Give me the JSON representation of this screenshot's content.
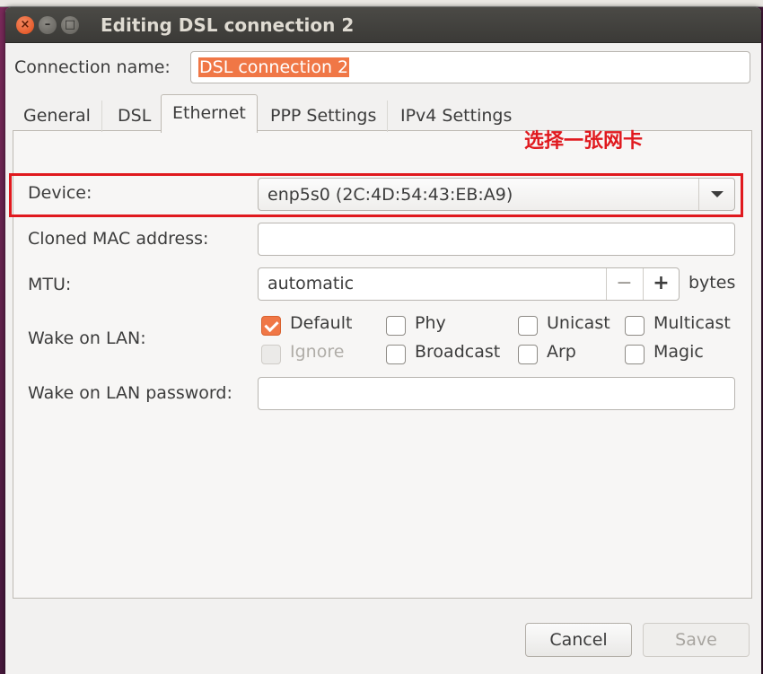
{
  "window": {
    "title": "Editing DSL connection 2",
    "controls": {
      "close": "×",
      "minimize": "–",
      "maximize": "□"
    }
  },
  "connection_name": {
    "label": "Connection name:",
    "value": "DSL connection 2"
  },
  "tabs": [
    {
      "label": "General"
    },
    {
      "label": "DSL"
    },
    {
      "label": "Ethernet",
      "active": true
    },
    {
      "label": "PPP Settings"
    },
    {
      "label": "IPv4 Settings"
    }
  ],
  "annotation": {
    "text": "选择一张网卡",
    "color": "#e0191e"
  },
  "ethernet": {
    "device": {
      "label": "Device:",
      "value": "enp5s0 (2C:4D:54:43:EB:A9)"
    },
    "cloned_mac": {
      "label": "Cloned MAC address:",
      "value": ""
    },
    "mtu": {
      "label": "MTU:",
      "value": "automatic",
      "minus": "−",
      "plus": "+",
      "unit": "bytes"
    },
    "wake_on_lan": {
      "label": "Wake on LAN:",
      "options": [
        {
          "label": "Default",
          "checked": true
        },
        {
          "label": "Phy",
          "checked": false
        },
        {
          "label": "Unicast",
          "checked": false
        },
        {
          "label": "Multicast",
          "checked": false
        },
        {
          "label": "Ignore",
          "checked": false,
          "disabled": true
        },
        {
          "label": "Broadcast",
          "checked": false
        },
        {
          "label": "Arp",
          "checked": false
        },
        {
          "label": "Magic",
          "checked": false
        }
      ]
    },
    "wol_password": {
      "label": "Wake on LAN password:",
      "value": ""
    }
  },
  "buttons": {
    "cancel": "Cancel",
    "save": "Save"
  },
  "colors": {
    "accent": "#f07746",
    "titlebar": "#3c3b37",
    "window_bg": "#f2f1f0"
  }
}
